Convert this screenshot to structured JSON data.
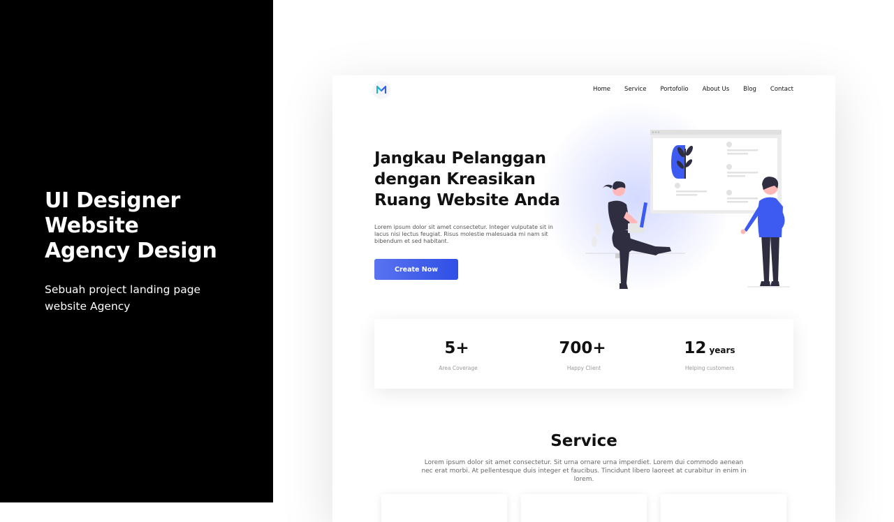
{
  "slide": {
    "title_lines": [
      "UI Designer",
      "Website",
      "Agency Design"
    ],
    "description": "Sebuah project landing page website Agency"
  },
  "site": {
    "logo_icon": "m-logo-icon",
    "nav": [
      "Home",
      "Service",
      "Portofolio",
      "About Us",
      "Blog",
      "Contact"
    ],
    "hero": {
      "title_lines": [
        "Jangkau Pelanggan",
        "dengan Kreasikan",
        "Ruang Website Anda"
      ],
      "description": "Lorem ipsum dolor sit amet consectetur. Integer vulputate sit in lacus nisi lectus feugiat. Risus molestie malesuada mi nam sit bibendum et sed habitant.",
      "cta_label": "Create Now"
    },
    "stats": [
      {
        "value": "5+",
        "unit": "",
        "label": "Area Coverage"
      },
      {
        "value": "700+",
        "unit": "",
        "label": "Happy Client"
      },
      {
        "value": "12",
        "unit": "years",
        "label": "Helping customers"
      }
    ],
    "service": {
      "title": "Service",
      "description": "Lorem ipsum dolor sit amet consectetur. Sit urna ornare urna imperdiet. Lorem dui commodo aenean nec erat morbi. At pellentesque duis integer et faucibus. Tincidunt libero laoreet at curabitur in enim in lorem."
    }
  },
  "colors": {
    "accent": "#3D5AF1",
    "left_panel": "#000000",
    "text_dark": "#111111",
    "figure_dark": "#2F2E41",
    "skin": "#FFB8B8"
  }
}
